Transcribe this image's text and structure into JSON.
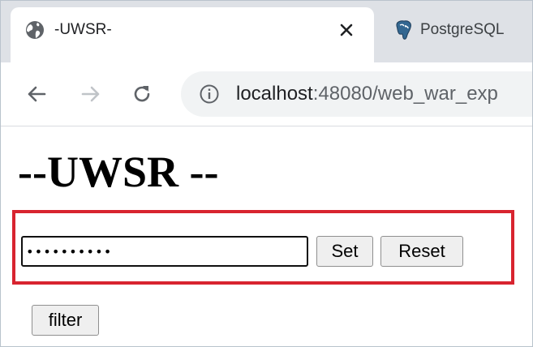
{
  "browser": {
    "tabs": [
      {
        "title": "-UWSR-",
        "icon": "globe-icon",
        "active": true
      },
      {
        "title": "PostgreSQL",
        "icon": "postgresql-elephant-icon",
        "active": false
      }
    ],
    "address_bar": {
      "host": "localhost",
      "path": ":48080/web_war_exp"
    }
  },
  "page": {
    "title": "--UWSR --",
    "password": {
      "value": "••••••••••",
      "type": "password"
    },
    "set_label": "Set",
    "reset_label": "Reset",
    "filter_label": "filter"
  },
  "colors": {
    "highlight_border": "#d8242f",
    "tab_strip": "#dee1e6",
    "omnibox": "#f1f3f4"
  }
}
